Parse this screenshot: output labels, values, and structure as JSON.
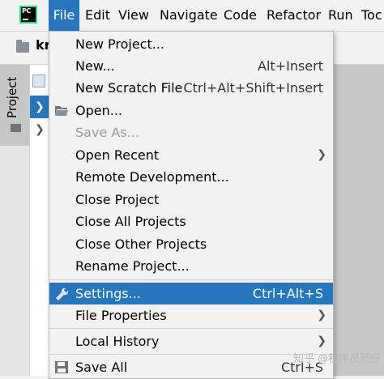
{
  "menubar": {
    "items": [
      {
        "label": "File"
      },
      {
        "label": "Edit"
      },
      {
        "label": "View"
      },
      {
        "label": "Navigate"
      },
      {
        "label": "Code"
      },
      {
        "label": "Refactor"
      },
      {
        "label": "Run"
      },
      {
        "label": "Toc"
      }
    ],
    "logo_text": "PC"
  },
  "breadcrumb": "kr",
  "sidebar": {
    "project_tab": "Project"
  },
  "file_menu": {
    "items": [
      {
        "label": "New Project...",
        "shortcut": ""
      },
      {
        "label": "New...",
        "shortcut": "Alt+Insert"
      },
      {
        "label": "New Scratch File",
        "shortcut": "Ctrl+Alt+Shift+Insert"
      },
      {
        "label": "Open...",
        "shortcut": ""
      },
      {
        "label": "Save As...",
        "shortcut": ""
      },
      {
        "label": "Open Recent",
        "shortcut": ""
      },
      {
        "label": "Remote Development...",
        "shortcut": ""
      },
      {
        "label": "Close Project",
        "shortcut": ""
      },
      {
        "label": "Close All Projects",
        "shortcut": ""
      },
      {
        "label": "Close Other Projects",
        "shortcut": ""
      },
      {
        "label": "Rename Project...",
        "shortcut": ""
      },
      {
        "label": "Settings...",
        "shortcut": "Ctrl+Alt+S"
      },
      {
        "label": "File Properties",
        "shortcut": ""
      },
      {
        "label": "Local History",
        "shortcut": ""
      },
      {
        "label": "Save All",
        "shortcut": "Ctrl+S"
      }
    ]
  },
  "watermark": "知乎 @程序员肥仔",
  "colors": {
    "accent": "#2675bf",
    "menu_bg": "#f2f2f2"
  }
}
